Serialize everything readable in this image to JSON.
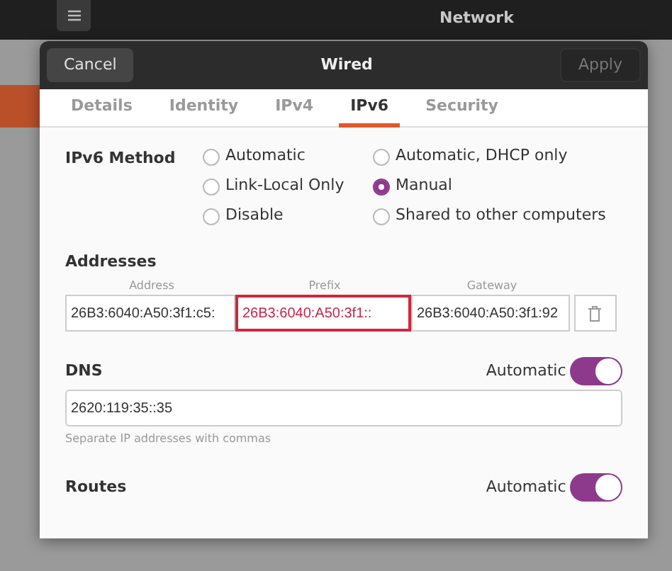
{
  "app": {
    "title": "Network"
  },
  "dialog": {
    "title": "Wired",
    "cancel": "Cancel",
    "apply": {
      "label": "Apply",
      "disabled": true
    }
  },
  "tabs": [
    {
      "label": "Details",
      "selected": false
    },
    {
      "label": "Identity",
      "selected": false
    },
    {
      "label": "IPv4",
      "selected": false
    },
    {
      "label": "IPv6",
      "selected": true
    },
    {
      "label": "Security",
      "selected": false
    }
  ],
  "ipv6_method": {
    "label": "IPv6 Method",
    "options": [
      {
        "label": "Automatic",
        "selected": false
      },
      {
        "label": "Link-Local Only",
        "selected": false
      },
      {
        "label": "Disable",
        "selected": false
      },
      {
        "label": "Automatic, DHCP only",
        "selected": false
      },
      {
        "label": "Manual",
        "selected": true
      },
      {
        "label": "Shared to other computers",
        "selected": false
      }
    ]
  },
  "addresses": {
    "heading": "Addresses",
    "columns": [
      "Address",
      "Prefix",
      "Gateway"
    ],
    "rows": [
      {
        "cells": [
          {
            "value": "26B3:6040:A50:3f1:c5:",
            "error": false
          },
          {
            "value": "26B3:6040:A50:3f1::",
            "error": true
          },
          {
            "value": "26B3:6040:A50:3f1:92",
            "error": false
          }
        ]
      }
    ]
  },
  "dns": {
    "heading": "DNS",
    "automatic_label": "Automatic",
    "automatic": true,
    "value": "2620:119:35::35",
    "hint": "Separate IP addresses with commas"
  },
  "routes": {
    "heading": "Routes",
    "automatic_label": "Automatic",
    "automatic": true
  }
}
